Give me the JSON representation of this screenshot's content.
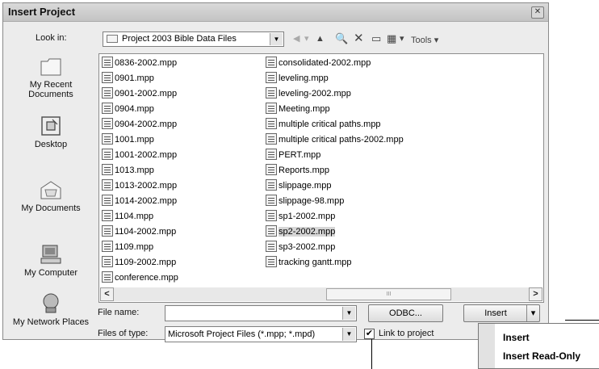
{
  "dialog": {
    "title": "Insert Project",
    "close_symbol": "✕"
  },
  "look_in": {
    "label": "Look in:",
    "value": "Project 2003 Bible Data Files"
  },
  "toolbar": {
    "back_symbol": "◀",
    "back_dropdown_symbol": "▾",
    "up_folder_symbol": "▲",
    "search_symbol": "🔍",
    "delete_symbol": "✕",
    "new_folder_symbol": "▭",
    "views_symbol": "▦",
    "views_dropdown_symbol": "▾",
    "tools_label": "Tools ▾"
  },
  "places": [
    {
      "label": "My Recent Documents",
      "icon": "recent-documents-icon"
    },
    {
      "label": "Desktop",
      "icon": "desktop-icon"
    },
    {
      "label": "My Documents",
      "icon": "my-documents-icon"
    },
    {
      "label": "My Computer",
      "icon": "my-computer-icon"
    },
    {
      "label": "My Network Places",
      "icon": "network-places-icon"
    }
  ],
  "files": {
    "column1": [
      "0836-2002.mpp",
      "0901.mpp",
      "0901-2002.mpp",
      "0904.mpp",
      "0904-2002.mpp",
      "1001.mpp",
      "1001-2002.mpp",
      "1013.mpp",
      "1013-2002.mpp",
      "1014-2002.mpp",
      "1104.mpp",
      "1104-2002.mpp",
      "1109.mpp",
      "1109-2002.mpp",
      "conference.mpp"
    ],
    "column2": [
      "consolidated-2002.mpp",
      "leveling.mpp",
      "leveling-2002.mpp",
      "Meeting.mpp",
      "multiple critical paths.mpp",
      "multiple critical paths-2002.mpp",
      "PERT.mpp",
      "Reports.mpp",
      "slippage.mpp",
      "slippage-98.mpp",
      "sp1-2002.mpp",
      "sp2-2002.mpp",
      "sp3-2002.mpp",
      "tracking gantt.mpp"
    ],
    "selected": "sp2-2002.mpp"
  },
  "scrollbar": {
    "left_symbol": "<",
    "right_symbol": ">",
    "thumb_grip": "III"
  },
  "file_name": {
    "label": "File name:",
    "value": ""
  },
  "files_of_type": {
    "label": "Files of type:",
    "value": "Microsoft Project Files (*.mpp; *.mpd)"
  },
  "buttons": {
    "odbc": "ODBC...",
    "insert": "Insert",
    "insert_dropdown_symbol": "▾"
  },
  "link_to_project": {
    "label": "Link to project",
    "checked": true,
    "check_symbol": "✔"
  },
  "insert_menu": {
    "items": [
      "Insert",
      "Insert Read-Only"
    ]
  },
  "combo_arrow_symbol": "▼"
}
